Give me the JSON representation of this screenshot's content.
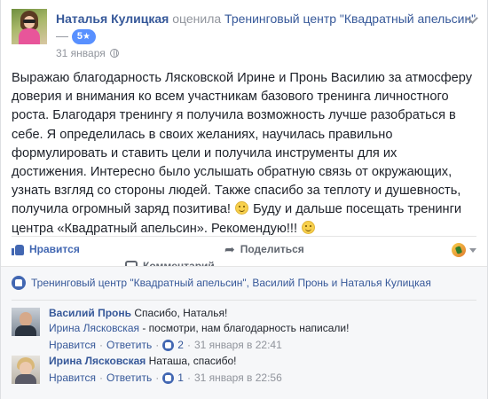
{
  "post": {
    "author": "Наталья Кулицкая",
    "action": "оценила",
    "page_name": "Тренинговый центр \"Квадратный апельсин\"",
    "dash": "—",
    "rating": "5",
    "star": "★",
    "date": "31 января",
    "text_parts": [
      "Выражаю благодарность Лясковской Ирине и Пронь Василию за атмосферу доверия и внимания ко всем участникам базового тренинга личностного роста. Благодаря тренингу я получила возможность лучше разобраться в себе. Я определилась в своих желаниях, научилась правильно формулировать и ставить цели и получила инструменты для их достижения. Интересно было услышать обратную связь от окружающих, узнать взгляд со стороны людей. Также спасибо за теплоту и душевность, получила огромный заряд позитива!",
      "Буду и дальше посещать тренинги центра «Квадратный апельсин». Рекомендую!!!"
    ]
  },
  "actions": {
    "like": "Нравится",
    "comment": "Комментарий",
    "share": "Поделиться"
  },
  "likers": "Тренинговый центр \"Квадратный апельсин\", Василий Пронь и Наталья Кулицкая",
  "comments": [
    {
      "author": "Василий Пронь",
      "text": "Спасибо, Наталья!",
      "reply_author": "Ирина Лясковская",
      "reply_text": "- посмотри, нам благодарность написали!",
      "like": "Нравится",
      "reply": "Ответить",
      "likes": "2",
      "time": "31 января в 22:41"
    },
    {
      "author": "Ирина Лясковская",
      "text": "Наташа, спасибо!",
      "like": "Нравится",
      "reply": "Ответить",
      "likes": "1",
      "time": "31 января в 22:56"
    }
  ],
  "colors": {
    "link": "#365899",
    "accent": "#4267b2",
    "badge": "#5890ff",
    "muted": "#90949c"
  }
}
